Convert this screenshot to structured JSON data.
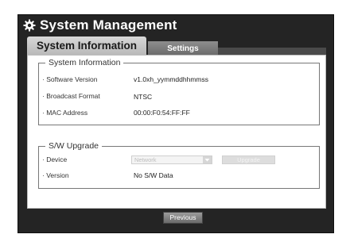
{
  "window": {
    "title": "System Management",
    "icon": "gear-icon"
  },
  "tabs": [
    {
      "label": "System Information",
      "active": true
    },
    {
      "label": "Settings",
      "active": false
    }
  ],
  "system_information": {
    "legend": "System Information",
    "rows": [
      {
        "label": "· Software Version",
        "value": "v1.0xh_yymmddhhmmss"
      },
      {
        "label": "· Broadcast Format",
        "value": "NTSC"
      },
      {
        "label": "· MAC Address",
        "value": "00:00:F0:54:FF:FF"
      }
    ]
  },
  "sw_upgrade": {
    "legend": "S/W Upgrade",
    "device": {
      "label": "· Device",
      "selected": "Network",
      "disabled": true
    },
    "upgrade_button": {
      "label": "Upgrade",
      "disabled": true
    },
    "version": {
      "label": "· Version",
      "value": "No S/W Data"
    }
  },
  "footer": {
    "previous_label": "Previous"
  },
  "colors": {
    "screen_bg": "#242424",
    "tab_active_bg": "#c8c8c8",
    "tab_inactive_bg": "#7d7d7d",
    "panel_bg": "#ffffff",
    "group_border": "#777777",
    "button_bg": "#7d7d7d"
  }
}
